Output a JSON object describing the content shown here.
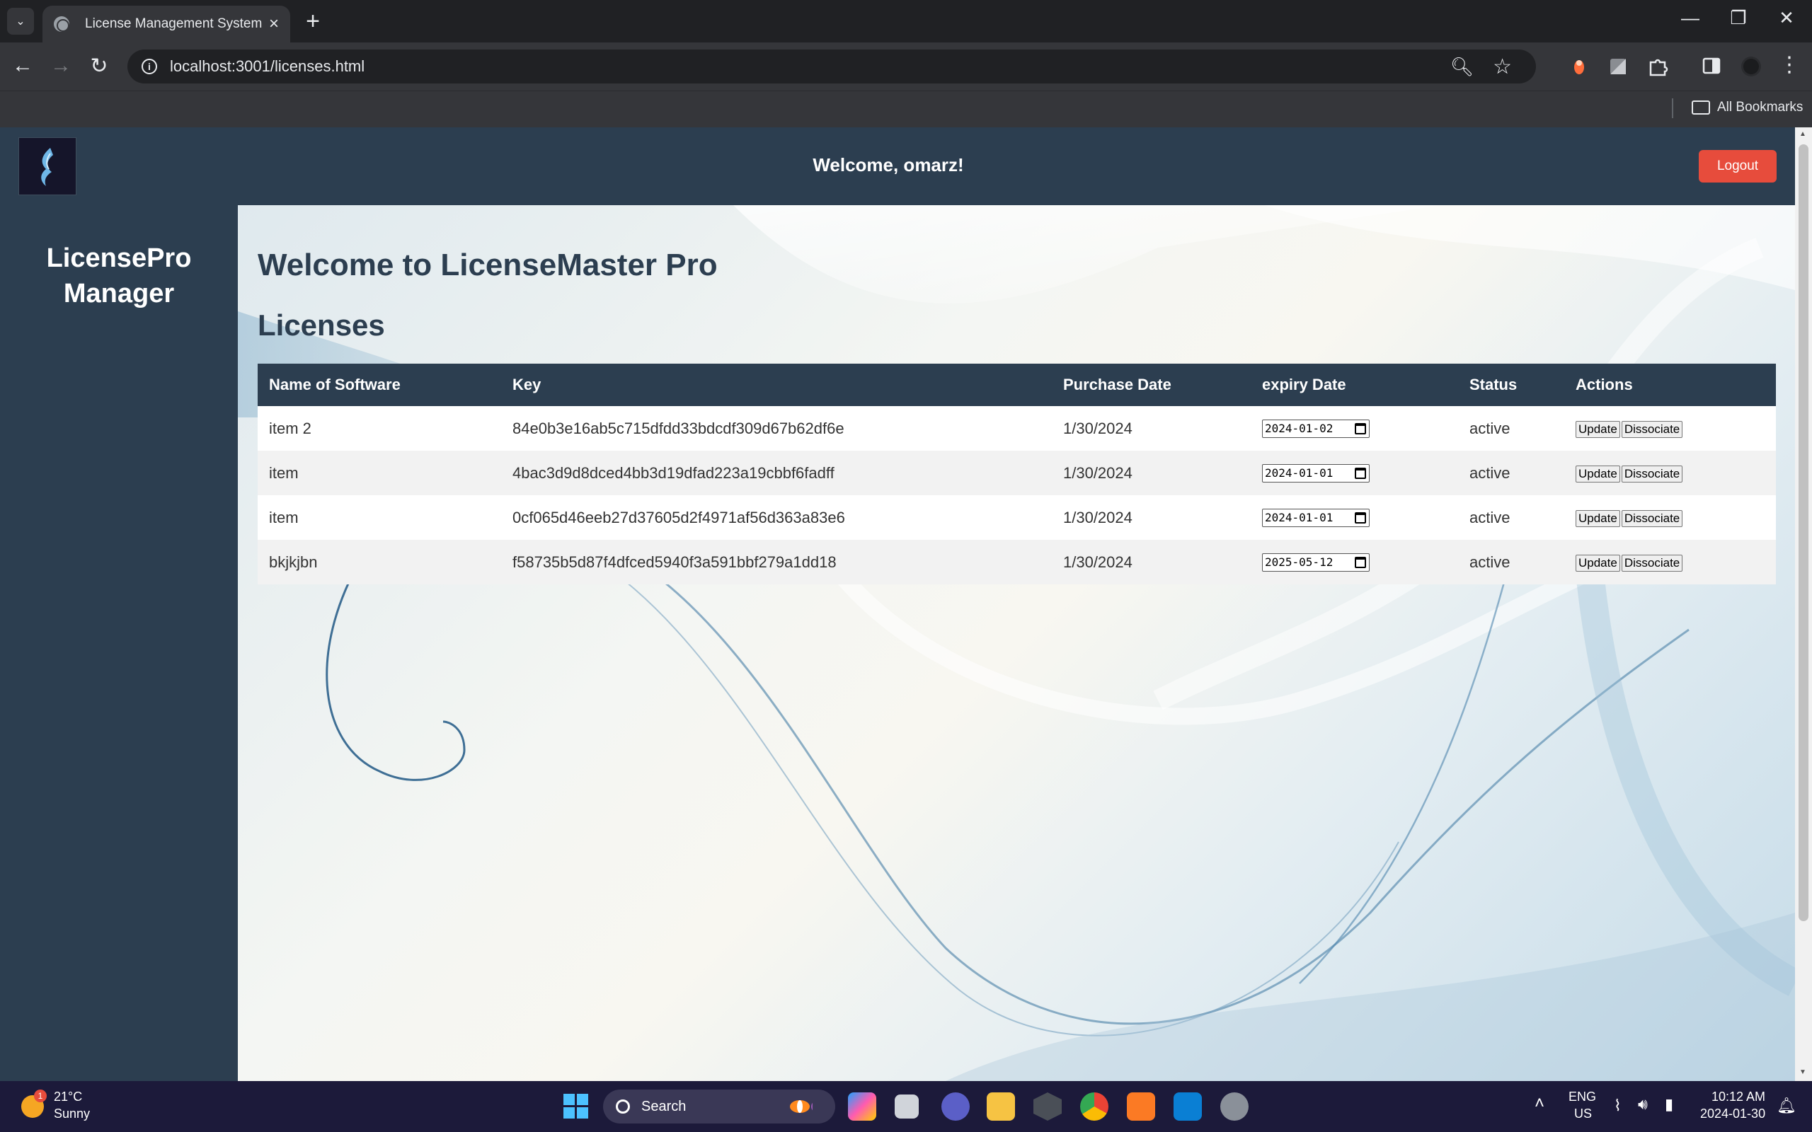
{
  "browser": {
    "tab_title": "License Management System",
    "url": "localhost:3001/licenses.html",
    "bookmarks_label": "All Bookmarks"
  },
  "header": {
    "welcome": "Welcome, omarz!",
    "logout_label": "Logout"
  },
  "sidebar": {
    "title": "LicensePro Manager"
  },
  "main": {
    "heading": "Welcome to LicenseMaster Pro",
    "subheading": "Licenses"
  },
  "table": {
    "columns": [
      "Name of Software",
      "Key",
      "Purchase Date",
      "expiry Date",
      "Status",
      "Actions"
    ],
    "rows": [
      {
        "name": "item 2",
        "key": "84e0b3e16ab5c715dfdd33bdcdf309d67b62df6e",
        "purchase": "1/30/2024",
        "expiry": "2024-01-02",
        "status": "active"
      },
      {
        "name": "item",
        "key": "4bac3d9d8dced4bb3d19dfad223a19cbbf6fadff",
        "purchase": "1/30/2024",
        "expiry": "2024-01-01",
        "status": "active"
      },
      {
        "name": "item",
        "key": "0cf065d46eeb27d37605d2f4971af56d363a83e6",
        "purchase": "1/30/2024",
        "expiry": "2024-01-01",
        "status": "active"
      },
      {
        "name": "bkjkjbn",
        "key": "f58735b5d87f4dfced5940f3a591bbf279a1dd18",
        "purchase": "1/30/2024",
        "expiry": "2025-05-12",
        "status": "active"
      }
    ],
    "update_label": "Update",
    "dissociate_label": "Dissociate"
  },
  "taskbar": {
    "weather_badge": "1",
    "temperature": "21°C",
    "weather": "Sunny",
    "search_label": "Search",
    "lang": "ENG",
    "region": "US",
    "time": "10:12 AM",
    "date": "2024-01-30"
  },
  "colors": {
    "header_bg": "#2c3e50",
    "logout_bg": "#e74c3c",
    "accent": "#4cc2ff"
  }
}
